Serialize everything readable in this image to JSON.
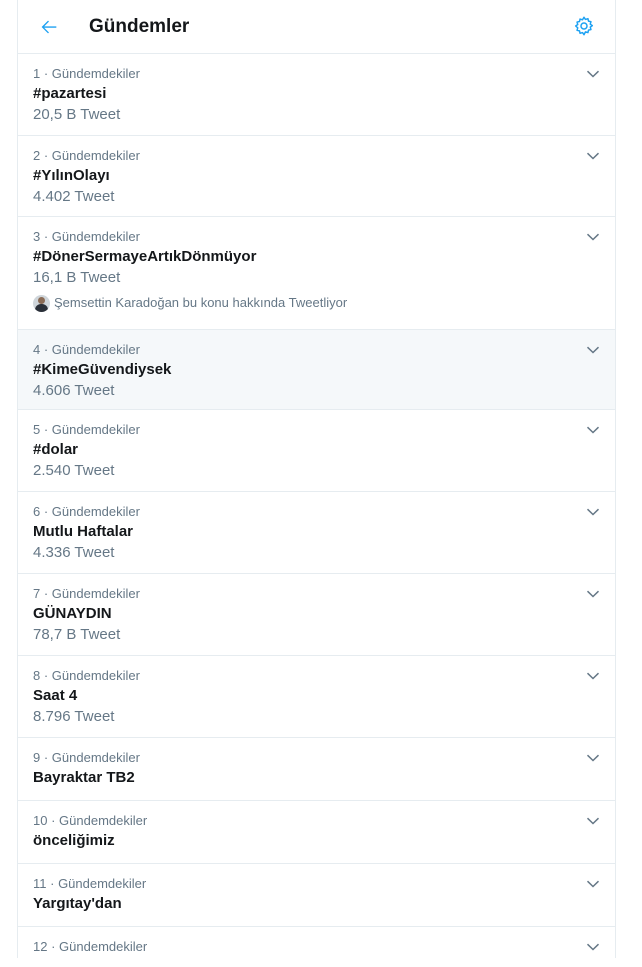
{
  "header": {
    "title": "Gündemler",
    "back_icon": "arrow-left-icon",
    "settings_icon": "gear-icon"
  },
  "accent_color": "#1da1f2",
  "trends": [
    {
      "rank": "1",
      "category": "Gündemdekiler",
      "name": "#pazartesi",
      "count": "20,5 B Tweet"
    },
    {
      "rank": "2",
      "category": "Gündemdekiler",
      "name": "#YılınOlayı",
      "count": "4.402 Tweet"
    },
    {
      "rank": "3",
      "category": "Gündemdekiler",
      "name": "#DönerSermayeArtıkDönmüyor",
      "count": "16,1 B Tweet",
      "context": "Şemsettin Karadoğan bu konu hakkında Tweetliyor"
    },
    {
      "rank": "4",
      "category": "Gündemdekiler",
      "name": "#KimeGüvendiysek",
      "count": "4.606 Tweet",
      "hovered": true
    },
    {
      "rank": "5",
      "category": "Gündemdekiler",
      "name": "#dolar",
      "count": "2.540 Tweet"
    },
    {
      "rank": "6",
      "category": "Gündemdekiler",
      "name": "Mutlu Haftalar",
      "count": "4.336 Tweet"
    },
    {
      "rank": "7",
      "category": "Gündemdekiler",
      "name": "GÜNAYDIN",
      "count": "78,7 B Tweet"
    },
    {
      "rank": "8",
      "category": "Gündemdekiler",
      "name": "Saat 4",
      "count": "8.796 Tweet"
    },
    {
      "rank": "9",
      "category": "Gündemdekiler",
      "name": "Bayraktar TB2"
    },
    {
      "rank": "10",
      "category": "Gündemdekiler",
      "name": "önceliğimiz"
    },
    {
      "rank": "11",
      "category": "Gündemdekiler",
      "name": "Yargıtay'dan"
    },
    {
      "rank": "12",
      "category": "Gündemdekiler"
    }
  ]
}
